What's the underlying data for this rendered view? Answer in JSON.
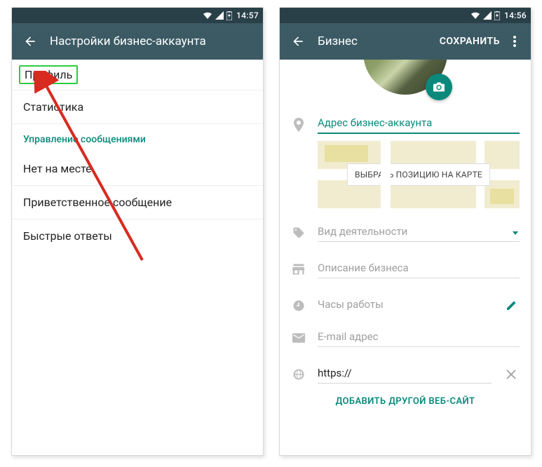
{
  "left": {
    "status_time": "14:57",
    "title": "Настройки бизнес-аккаунта",
    "items": {
      "profile": "Профиль",
      "stats": "Статистика",
      "section": "Управление сообщениями",
      "away": "Нет на месте",
      "greeting": "Приветственное сообщение",
      "quick": "Быстрые ответы"
    }
  },
  "right": {
    "status_time": "14:56",
    "title": "Бизнес",
    "save_label": "СОХРАНИТЬ",
    "fields": {
      "address": "Адрес бизнес-аккаунта",
      "map_button": "ВЫБРАТЬ ПОЗИЦИЮ НА КАРТЕ",
      "category": "Вид деятельности",
      "description": "Описание бизнеса",
      "hours": "Часы работы",
      "email": "E-mail адрес",
      "url": "https://",
      "add_site": "ДОБАВИТЬ ДРУГОЙ ВЕБ-САЙТ"
    }
  }
}
